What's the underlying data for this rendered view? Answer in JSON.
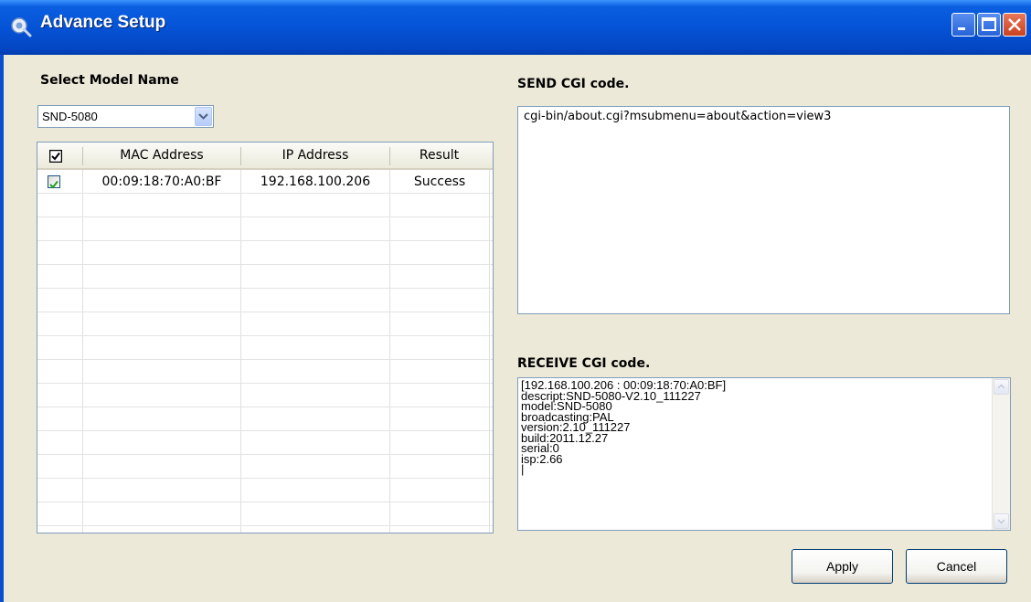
{
  "window": {
    "title": "Advance Setup"
  },
  "model": {
    "label": "Select Model Name",
    "selected": "SND-5080"
  },
  "device_table": {
    "columns": [
      "MAC Address",
      "IP Address",
      "Result"
    ],
    "rows": [
      {
        "checked": true,
        "mac": "00:09:18:70:A0:BF",
        "ip": "192.168.100.206",
        "result": "Success"
      }
    ]
  },
  "send": {
    "label": "SEND CGI code.",
    "value": "cgi-bin/about.cgi?msubmenu=about&action=view3"
  },
  "receive": {
    "label": "RECEIVE CGI code.",
    "lines": [
      "[192.168.100.206 : 00:09:18:70:A0:BF]",
      "descript:SND-5080-V2.10_111227",
      "model:SND-5080",
      "broadcasting:PAL",
      "version:2.10_111227",
      "build:2011.12.27",
      "serial:0",
      "isp:2.66",
      "|"
    ]
  },
  "buttons": {
    "apply": "Apply",
    "cancel": "Cancel"
  }
}
